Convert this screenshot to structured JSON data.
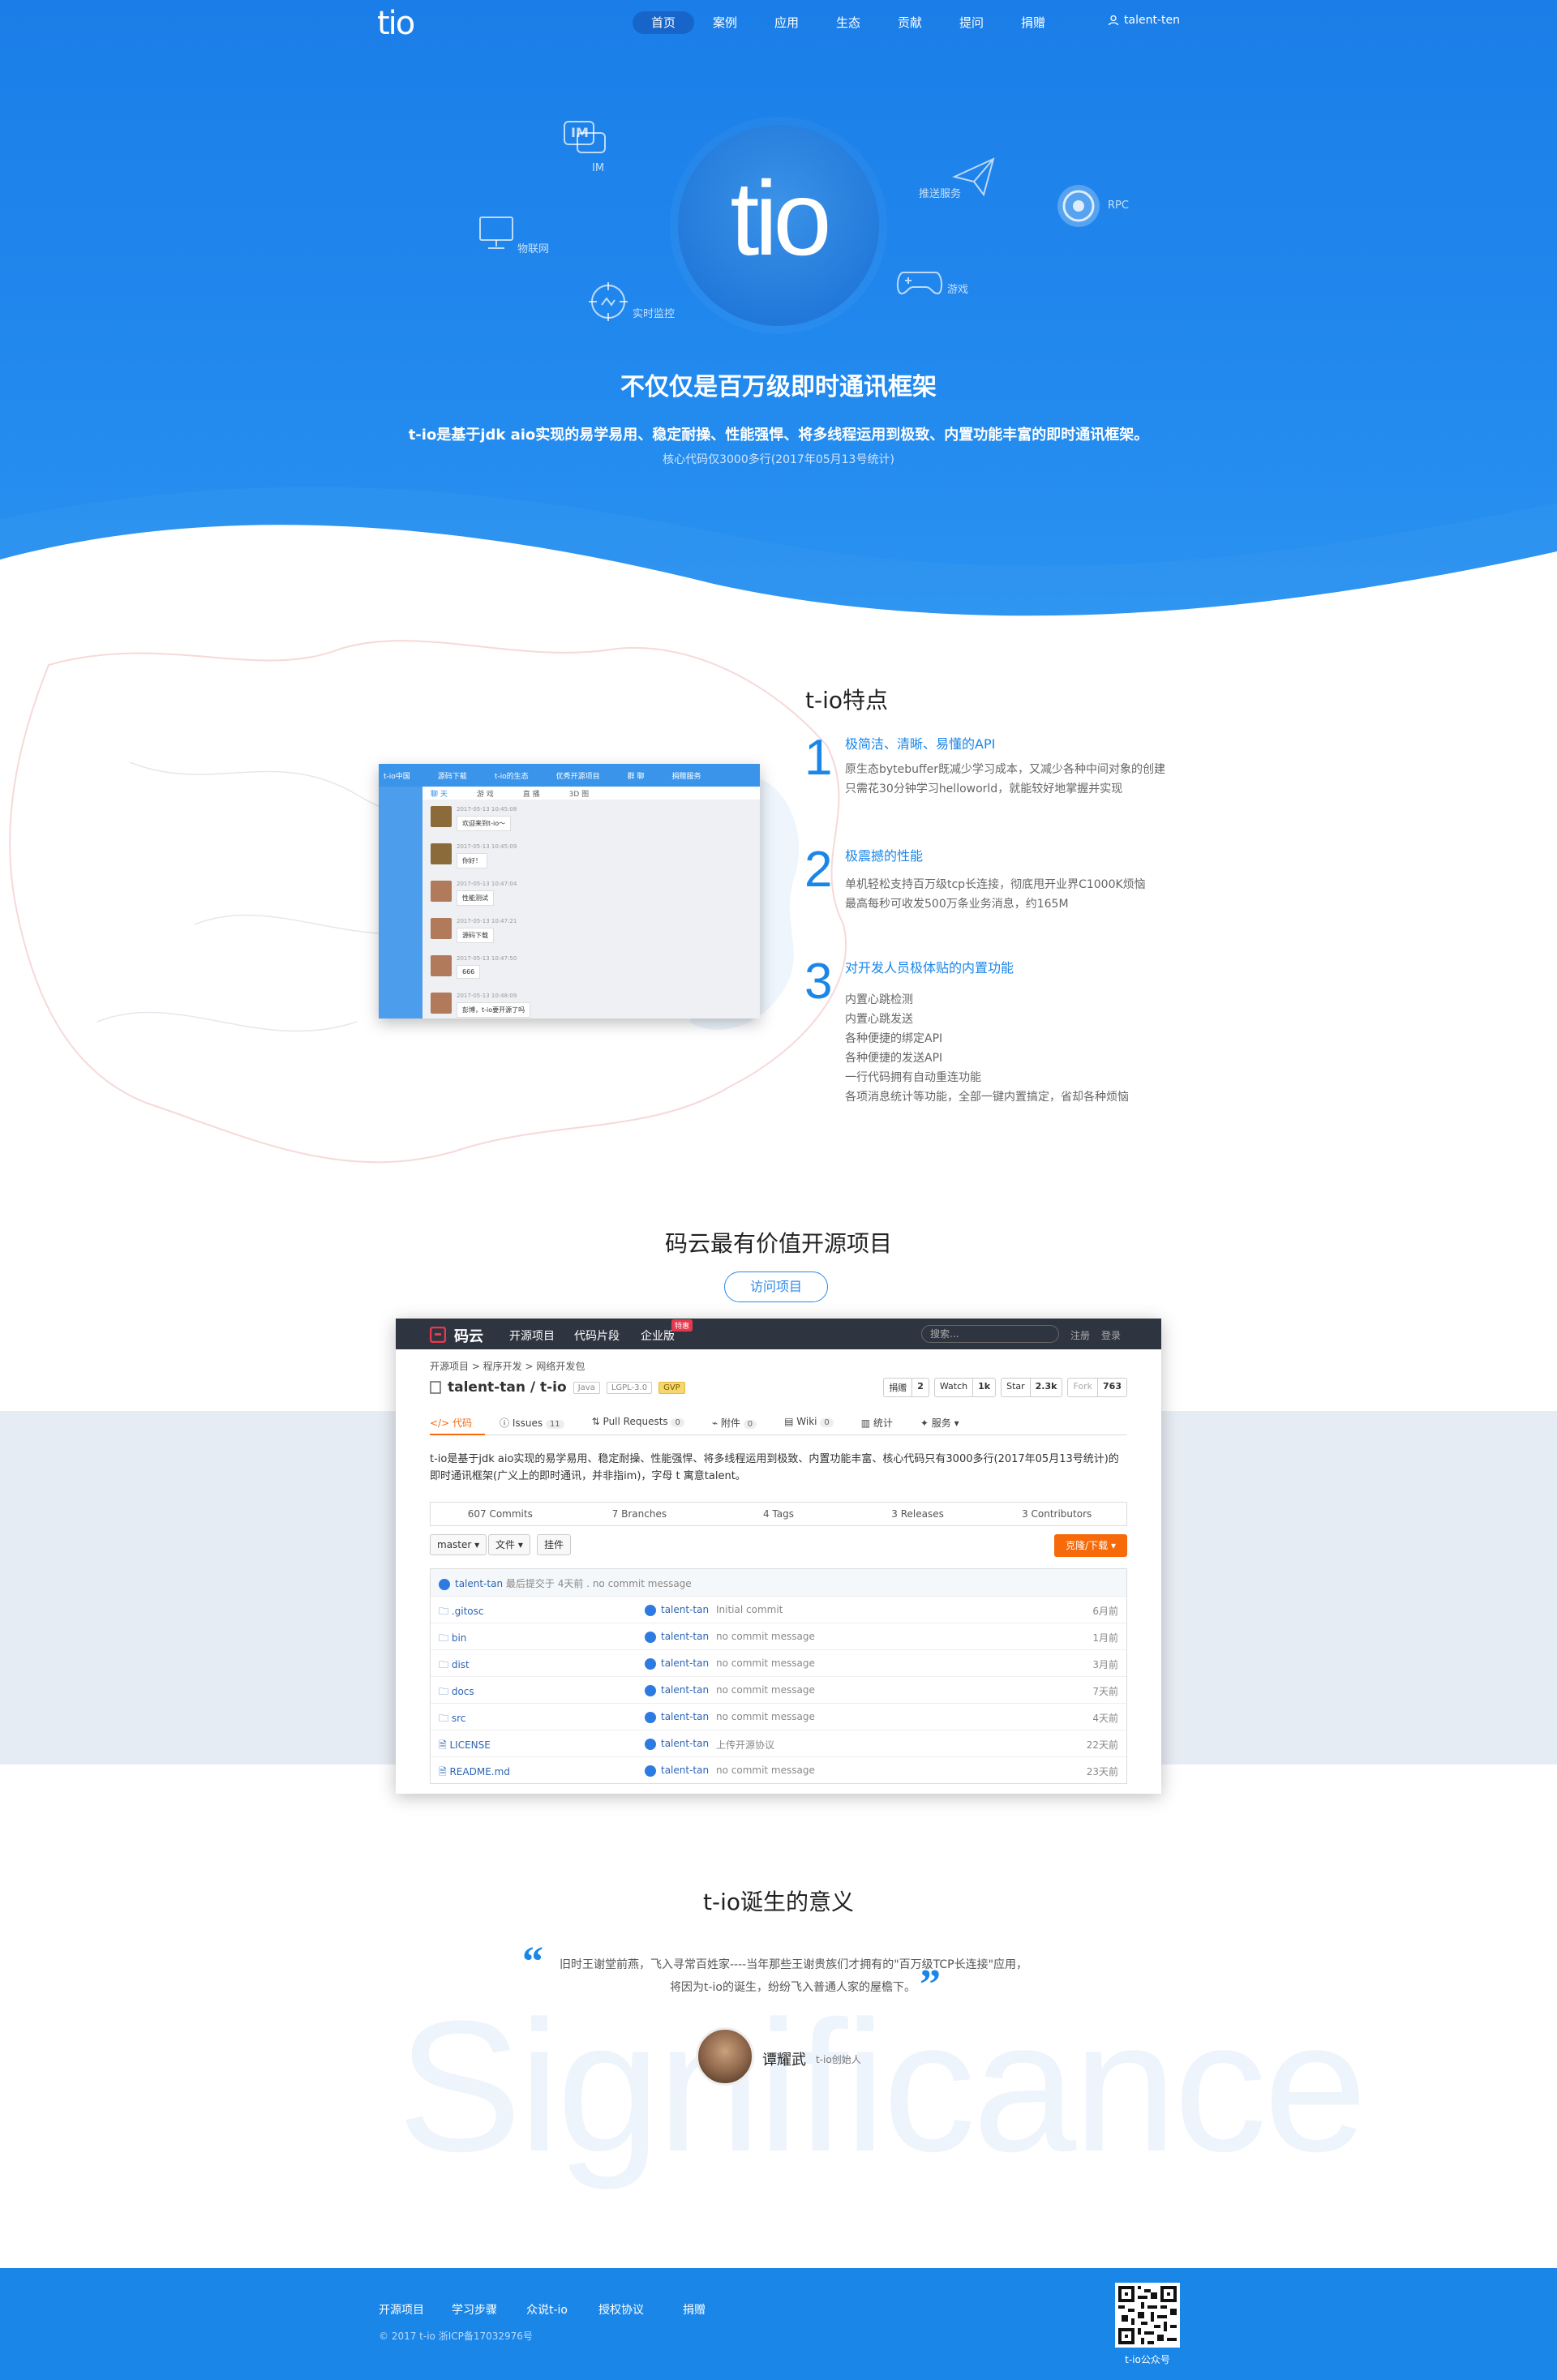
{
  "nav": {
    "logo": "tio",
    "items": [
      "首页",
      "案例",
      "应用",
      "生态",
      "贡献",
      "提问",
      "捐赠"
    ],
    "active_index": 0,
    "user": "talent-ten"
  },
  "hero": {
    "logo": "tio",
    "orbit": [
      "IM",
      "物联网",
      "实时监控",
      "推送服务",
      "游戏",
      "RPC"
    ],
    "title": "不仅仅是百万级即时通讯框架",
    "desc": "t-io是基于jdk aio实现的易学易用、稳定耐操、性能强悍、将多线程运用到极致、内置功能丰富的即时通讯框架。",
    "sub": "核心代码仅3000多行(2017年05月13号统计)"
  },
  "features": {
    "title": "t-io特点",
    "items": [
      {
        "num": "1",
        "heading": "极简洁、清晰、易懂的API",
        "lines": [
          "原生态bytebuffer既减少学习成本，又减少各种中间对象的创建",
          "只需花30分钟学习helloworld，就能较好地掌握并实现"
        ]
      },
      {
        "num": "2",
        "heading": "极震撼的性能",
        "lines": [
          "单机轻松支持百万级tcp长连接，彻底甩开业界C1000K烦恼",
          "最高每秒可收发500万条业务消息，约165M"
        ]
      },
      {
        "num": "3",
        "heading": "对开发人员极体贴的内置功能",
        "lines": [
          "内置心跳检测",
          "内置心跳发送",
          "各种便捷的绑定API",
          "各种便捷的发送API",
          "一行代码拥有自动重连功能",
          "各项消息统计等功能，全部一键内置搞定，省却各种烦恼"
        ]
      }
    ],
    "chat": {
      "top": [
        "t-io中国",
        "源码下载",
        "t-io的生态",
        "优秀开源项目",
        "群 聊",
        "捐赠服务"
      ],
      "tabs": [
        "聊 天",
        "游 戏",
        "直 播",
        "3D 图"
      ],
      "messages": [
        {
          "meta": "2017-05-13 10:45:08",
          "text": "欢迎来到t-io～"
        },
        {
          "meta": "2017-05-13 10:45:09",
          "text": "你好！"
        },
        {
          "meta": "2017-05-13 10:47:04",
          "text": "性能测试"
        },
        {
          "meta": "2017-05-13 10:47:21",
          "text": "源码下载"
        },
        {
          "meta": "2017-05-13 10:47:50",
          "text": "666"
        },
        {
          "meta": "2017-05-13 10:48:09",
          "text": "彭博，t-io要开源了吗"
        }
      ]
    }
  },
  "gitee_section": {
    "title": "码云最有价值开源项目",
    "button": "访问项目",
    "header": {
      "logo": "码云",
      "menu": [
        "开源项目",
        "代码片段",
        "企业版"
      ],
      "hot": "特惠",
      "search_placeholder": "搜索...",
      "login": "注册",
      "register": "登录"
    },
    "crumb": "开源项目 > 程序开发 > 网络开发包",
    "repo": "talent-tan / t-io",
    "tags": [
      "Java",
      "LGPL-3.0",
      "GVP"
    ],
    "stats": [
      {
        "label": "捐赠",
        "value": "2"
      },
      {
        "label": "Watch",
        "value": "1k"
      },
      {
        "label": "Star",
        "value": "2.3k"
      },
      {
        "label": "Fork",
        "value": "763"
      }
    ],
    "tabs": [
      {
        "label": "代码",
        "count": ""
      },
      {
        "label": "Issues",
        "count": "11"
      },
      {
        "label": "Pull Requests",
        "count": "0"
      },
      {
        "label": "附件",
        "count": "0"
      },
      {
        "label": "Wiki",
        "count": "0"
      },
      {
        "label": "统计",
        "count": ""
      },
      {
        "label": "服务",
        "count": ""
      }
    ],
    "description": "t-io是基于jdk aio实现的易学易用、稳定耐操、性能强悍、将多线程运用到极致、内置功能丰富、核心代码只有3000多行(2017年05月13号统计)的即时通讯框架(广义上的即时通讯，并非指im)，字母 t 寓意talent。",
    "meta": [
      "607 Commits",
      "7 Branches",
      "4 Tags",
      "3 Releases",
      "3 Contributors"
    ],
    "branch": "master",
    "file_btn": "文件",
    "attach_btn": "挂件",
    "clone": "克隆/下载",
    "latest": {
      "author": "talent-tan",
      "text": "最后提交于 4天前 . no commit message"
    },
    "files": [
      {
        "name": ".gitosc",
        "author": "talent-tan",
        "msg": "Initial commit",
        "time": "6月前"
      },
      {
        "name": "bin",
        "author": "talent-tan",
        "msg": "no commit message",
        "time": "1月前"
      },
      {
        "name": "dist",
        "author": "talent-tan",
        "msg": "no commit message",
        "time": "3月前"
      },
      {
        "name": "docs",
        "author": "talent-tan",
        "msg": "no commit message",
        "time": "7天前"
      },
      {
        "name": "src",
        "author": "talent-tan",
        "msg": "no commit message",
        "time": "4天前"
      },
      {
        "name": "LICENSE",
        "author": "talent-tan",
        "msg": "上传开源协议",
        "time": "22天前"
      },
      {
        "name": "README.md",
        "author": "talent-tan",
        "msg": "no commit message",
        "time": "23天前"
      }
    ]
  },
  "significance": {
    "title": "t-io诞生的意义",
    "bg_word": "Significance",
    "quote_line1": "旧时王谢堂前燕，飞入寻常百姓家----当年那些王谢贵族们才拥有的\"百万级TCP长连接\"应用，",
    "quote_line2": "将因为t-io的诞生，纷纷飞入普通人家的屋檐下。",
    "author": "谭耀武",
    "role": "t-io创始人"
  },
  "footer": {
    "links": [
      "开源项目",
      "学习步骤",
      "众说t-io",
      "授权协议",
      "捐赠"
    ],
    "copyright": "© 2017 t-io   浙ICP备17032976号",
    "qr_label": "t-io公众号"
  },
  "colors": {
    "primary": "#1a86e8",
    "hero_top": "#1b7ee8",
    "accent_orange": "#f66a0a",
    "footer": "#1a86e8"
  }
}
